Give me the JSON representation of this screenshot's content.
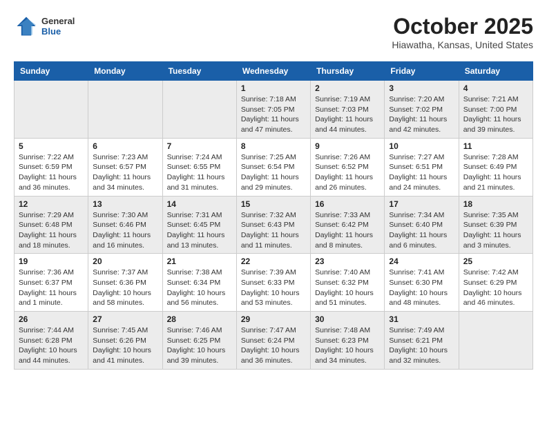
{
  "header": {
    "logo_general": "General",
    "logo_blue": "Blue",
    "month": "October 2025",
    "location": "Hiawatha, Kansas, United States"
  },
  "weekdays": [
    "Sunday",
    "Monday",
    "Tuesday",
    "Wednesday",
    "Thursday",
    "Friday",
    "Saturday"
  ],
  "weeks": [
    [
      {
        "day": "",
        "info": ""
      },
      {
        "day": "",
        "info": ""
      },
      {
        "day": "",
        "info": ""
      },
      {
        "day": "1",
        "info": "Sunrise: 7:18 AM\nSunset: 7:05 PM\nDaylight: 11 hours and 47 minutes."
      },
      {
        "day": "2",
        "info": "Sunrise: 7:19 AM\nSunset: 7:03 PM\nDaylight: 11 hours and 44 minutes."
      },
      {
        "day": "3",
        "info": "Sunrise: 7:20 AM\nSunset: 7:02 PM\nDaylight: 11 hours and 42 minutes."
      },
      {
        "day": "4",
        "info": "Sunrise: 7:21 AM\nSunset: 7:00 PM\nDaylight: 11 hours and 39 minutes."
      }
    ],
    [
      {
        "day": "5",
        "info": "Sunrise: 7:22 AM\nSunset: 6:59 PM\nDaylight: 11 hours and 36 minutes."
      },
      {
        "day": "6",
        "info": "Sunrise: 7:23 AM\nSunset: 6:57 PM\nDaylight: 11 hours and 34 minutes."
      },
      {
        "day": "7",
        "info": "Sunrise: 7:24 AM\nSunset: 6:55 PM\nDaylight: 11 hours and 31 minutes."
      },
      {
        "day": "8",
        "info": "Sunrise: 7:25 AM\nSunset: 6:54 PM\nDaylight: 11 hours and 29 minutes."
      },
      {
        "day": "9",
        "info": "Sunrise: 7:26 AM\nSunset: 6:52 PM\nDaylight: 11 hours and 26 minutes."
      },
      {
        "day": "10",
        "info": "Sunrise: 7:27 AM\nSunset: 6:51 PM\nDaylight: 11 hours and 24 minutes."
      },
      {
        "day": "11",
        "info": "Sunrise: 7:28 AM\nSunset: 6:49 PM\nDaylight: 11 hours and 21 minutes."
      }
    ],
    [
      {
        "day": "12",
        "info": "Sunrise: 7:29 AM\nSunset: 6:48 PM\nDaylight: 11 hours and 18 minutes."
      },
      {
        "day": "13",
        "info": "Sunrise: 7:30 AM\nSunset: 6:46 PM\nDaylight: 11 hours and 16 minutes."
      },
      {
        "day": "14",
        "info": "Sunrise: 7:31 AM\nSunset: 6:45 PM\nDaylight: 11 hours and 13 minutes."
      },
      {
        "day": "15",
        "info": "Sunrise: 7:32 AM\nSunset: 6:43 PM\nDaylight: 11 hours and 11 minutes."
      },
      {
        "day": "16",
        "info": "Sunrise: 7:33 AM\nSunset: 6:42 PM\nDaylight: 11 hours and 8 minutes."
      },
      {
        "day": "17",
        "info": "Sunrise: 7:34 AM\nSunset: 6:40 PM\nDaylight: 11 hours and 6 minutes."
      },
      {
        "day": "18",
        "info": "Sunrise: 7:35 AM\nSunset: 6:39 PM\nDaylight: 11 hours and 3 minutes."
      }
    ],
    [
      {
        "day": "19",
        "info": "Sunrise: 7:36 AM\nSunset: 6:37 PM\nDaylight: 11 hours and 1 minute."
      },
      {
        "day": "20",
        "info": "Sunrise: 7:37 AM\nSunset: 6:36 PM\nDaylight: 10 hours and 58 minutes."
      },
      {
        "day": "21",
        "info": "Sunrise: 7:38 AM\nSunset: 6:34 PM\nDaylight: 10 hours and 56 minutes."
      },
      {
        "day": "22",
        "info": "Sunrise: 7:39 AM\nSunset: 6:33 PM\nDaylight: 10 hours and 53 minutes."
      },
      {
        "day": "23",
        "info": "Sunrise: 7:40 AM\nSunset: 6:32 PM\nDaylight: 10 hours and 51 minutes."
      },
      {
        "day": "24",
        "info": "Sunrise: 7:41 AM\nSunset: 6:30 PM\nDaylight: 10 hours and 48 minutes."
      },
      {
        "day": "25",
        "info": "Sunrise: 7:42 AM\nSunset: 6:29 PM\nDaylight: 10 hours and 46 minutes."
      }
    ],
    [
      {
        "day": "26",
        "info": "Sunrise: 7:44 AM\nSunset: 6:28 PM\nDaylight: 10 hours and 44 minutes."
      },
      {
        "day": "27",
        "info": "Sunrise: 7:45 AM\nSunset: 6:26 PM\nDaylight: 10 hours and 41 minutes."
      },
      {
        "day": "28",
        "info": "Sunrise: 7:46 AM\nSunset: 6:25 PM\nDaylight: 10 hours and 39 minutes."
      },
      {
        "day": "29",
        "info": "Sunrise: 7:47 AM\nSunset: 6:24 PM\nDaylight: 10 hours and 36 minutes."
      },
      {
        "day": "30",
        "info": "Sunrise: 7:48 AM\nSunset: 6:23 PM\nDaylight: 10 hours and 34 minutes."
      },
      {
        "day": "31",
        "info": "Sunrise: 7:49 AM\nSunset: 6:21 PM\nDaylight: 10 hours and 32 minutes."
      },
      {
        "day": "",
        "info": ""
      }
    ]
  ]
}
